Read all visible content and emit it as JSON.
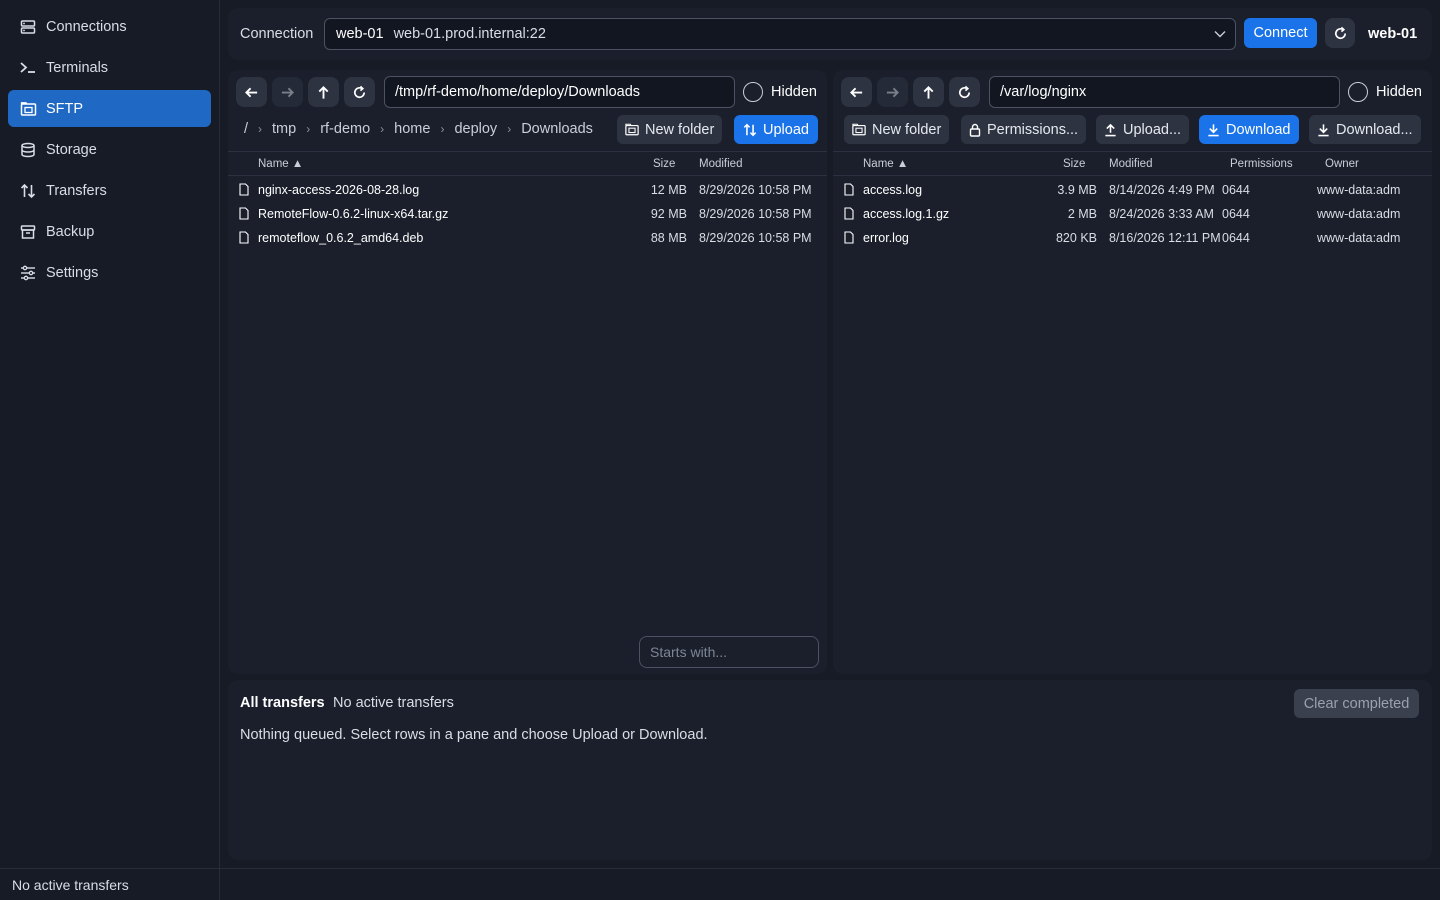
{
  "sidebar": {
    "items": [
      {
        "label": "Connections",
        "icon": "connections-icon"
      },
      {
        "label": "Terminals",
        "icon": "terminal-icon"
      },
      {
        "label": "SFTP",
        "icon": "sftp-icon",
        "active": true
      },
      {
        "label": "Storage",
        "icon": "storage-icon"
      },
      {
        "label": "Transfers",
        "icon": "transfers-icon"
      },
      {
        "label": "Backup",
        "icon": "backup-icon"
      },
      {
        "label": "Settings",
        "icon": "settings-icon"
      }
    ]
  },
  "status_bar": {
    "text": "No active transfers"
  },
  "connection": {
    "label": "Connection",
    "selected_name": "web-01",
    "selected_host": "web-01.prod.internal:22",
    "connect_label": "Connect",
    "session_name": "web-01"
  },
  "left_pane": {
    "path": "/tmp/rf-demo/home/deploy/Downloads",
    "hidden_label": "Hidden",
    "breadcrumb": [
      "/",
      "tmp",
      "rf-demo",
      "home",
      "deploy",
      "Downloads"
    ],
    "new_folder_label": "New folder",
    "upload_label": "Upload",
    "columns": {
      "name": "Name ▲",
      "size": "Size",
      "modified": "Modified"
    },
    "files": [
      {
        "name": "nginx-access-2026-08-28.log",
        "size": "12 MB",
        "modified": "8/29/2026 10:58 PM"
      },
      {
        "name": "RemoteFlow-0.6.2-linux-x64.tar.gz",
        "size": "92 MB",
        "modified": "8/29/2026 10:58 PM"
      },
      {
        "name": "remoteflow_0.6.2_amd64.deb",
        "size": "88 MB",
        "modified": "8/29/2026 10:58 PM"
      }
    ],
    "filter_placeholder": "Starts with..."
  },
  "right_pane": {
    "path": "/var/log/nginx",
    "hidden_label": "Hidden",
    "new_folder_label": "New folder",
    "permissions_label": "Permissions...",
    "upload_label": "Upload...",
    "download_label": "Download",
    "download_to_label": "Download...",
    "columns": {
      "name": "Name ▲",
      "size": "Size",
      "modified": "Modified",
      "permissions": "Permissions",
      "owner": "Owner"
    },
    "files": [
      {
        "name": "access.log",
        "size": "3.9 MB",
        "modified": "8/14/2026 4:49 PM",
        "permissions": "0644",
        "owner": "www-data:adm"
      },
      {
        "name": "access.log.1.gz",
        "size": "2 MB",
        "modified": "8/24/2026 3:33 AM",
        "permissions": "0644",
        "owner": "www-data:adm"
      },
      {
        "name": "error.log",
        "size": "820 KB",
        "modified": "8/16/2026 12:11 PM",
        "permissions": "0644",
        "owner": "www-data:adm"
      }
    ]
  },
  "transfers": {
    "title": "All transfers",
    "status": "No active transfers",
    "empty_message": "Nothing queued. Select rows in a pane and choose Upload or Download.",
    "clear_label": "Clear completed"
  },
  "colors": {
    "accent": "#1a73e8",
    "background": "#161b25",
    "panel": "#1a1f2b"
  }
}
